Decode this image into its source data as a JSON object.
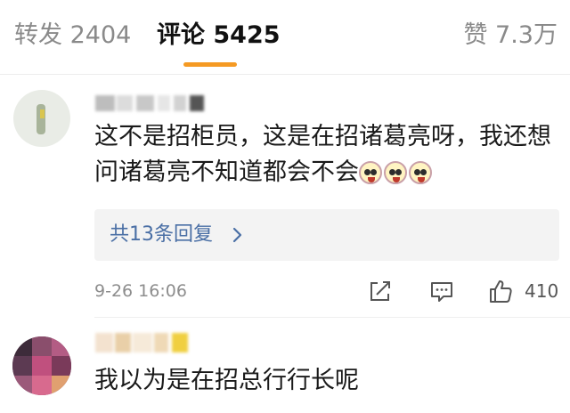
{
  "tabs": [
    {
      "label": "转发 2404"
    },
    {
      "label": "评论 5425"
    },
    {
      "label": "赞 7.3万"
    }
  ],
  "comments": [
    {
      "text_line1": "这不是招柜员，这是在招诸葛亮呀，我还想",
      "text_line2": "问诸葛亮不知道都会不会",
      "emoji_icon": "astonished-face-emoji",
      "replies_label": "共13条回复",
      "timestamp": "9-26 16:06",
      "like_count": "410"
    },
    {
      "text_line1": "我以为是在招总行行长呢"
    }
  ],
  "colors": {
    "accent": "#f59a23",
    "link": "#4a6fa5",
    "muted": "#8a8a8a",
    "reply_bg": "#f3f3f3"
  }
}
